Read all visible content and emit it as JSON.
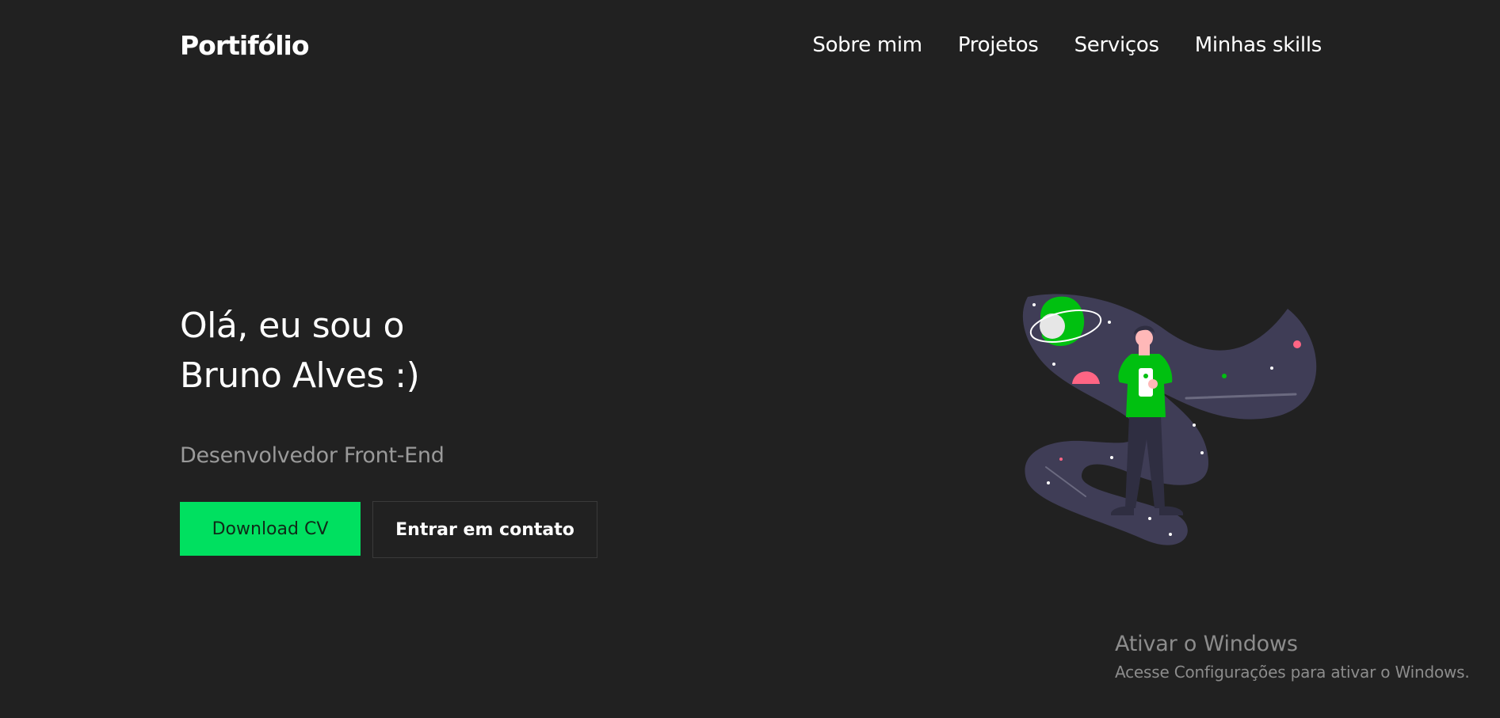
{
  "header": {
    "logo": "Portifólio",
    "nav": [
      {
        "label": "Sobre mim"
      },
      {
        "label": "Projetos"
      },
      {
        "label": "Serviços"
      },
      {
        "label": "Minhas skills"
      }
    ]
  },
  "hero": {
    "title_line1": "Olá, eu sou o",
    "title_line2": "Bruno Alves :)",
    "subtitle": "Desenvolvedor Front-End",
    "primary_button": "Download CV",
    "secondary_button": "Entrar em contato"
  },
  "illustration": {
    "icon": "person-in-space-illustration",
    "colors": {
      "accent": "#00c010",
      "blob": "#3f3d56",
      "pink": "#ff6584",
      "skin": "#ffb8b8"
    }
  },
  "watermark": {
    "title": "Ativar o Windows",
    "subtitle": "Acesse Configurações para ativar o Windows."
  },
  "colors": {
    "background": "#212121",
    "accent": "#00e060",
    "text": "#ffffff",
    "muted": "#9a9a9a"
  }
}
